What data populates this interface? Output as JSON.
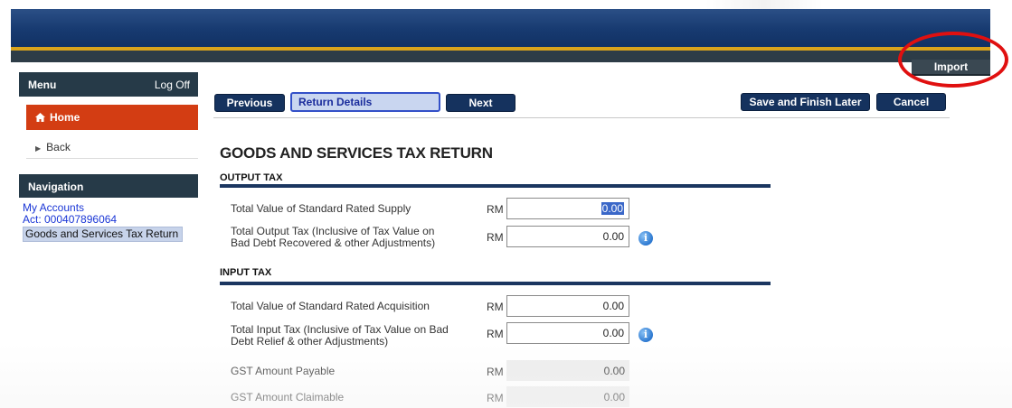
{
  "header": {
    "import_label": "Import"
  },
  "sidebar": {
    "menu_label": "Menu",
    "logoff_label": "Log Off",
    "home_label": "Home",
    "back_label": "Back",
    "navigation_label": "Navigation",
    "nav_links": [
      "My Accounts",
      "Act: 000407896064"
    ],
    "current_page": "Goods and Services Tax Return"
  },
  "toolbar": {
    "previous_label": "Previous",
    "current_step": "Return Details",
    "next_label": "Next",
    "save_label": "Save and Finish Later",
    "cancel_label": "Cancel"
  },
  "form": {
    "title": "GOODS AND SERVICES TAX RETURN",
    "currency": "RM",
    "output_tax": {
      "heading": "OUTPUT TAX",
      "standard_supply_label": "Total Value of Standard Rated Supply",
      "standard_supply_value": "0.00",
      "output_tax_label_1": "Total Output Tax (Inclusive of Tax Value on",
      "output_tax_label_2": "Bad Debt Recovered & other Adjustments)",
      "output_tax_value": "0.00"
    },
    "input_tax": {
      "heading": "INPUT TAX",
      "standard_acquisition_label": "Total Value of Standard Rated Acquisition",
      "standard_acquisition_value": "0.00",
      "input_tax_label_1": "Total Input Tax (Inclusive of Tax Value on Bad",
      "input_tax_label_2": "Debt Relief & other Adjustments)",
      "input_tax_value": "0.00",
      "payable_label": "GST Amount Payable",
      "payable_value": "0.00",
      "claimable_label": "GST Amount Claimable",
      "claimable_value": "0.00"
    }
  },
  "colors": {
    "banner_blue": "#173a70",
    "banner_gold": "#d9a31c",
    "home_orange": "#d33d13",
    "button_navy": "#15325e",
    "annotation_red": "#e01010",
    "link_blue": "#1a36d6"
  },
  "icons": [
    "home-icon",
    "chevron-right-icon",
    "info-icon"
  ]
}
